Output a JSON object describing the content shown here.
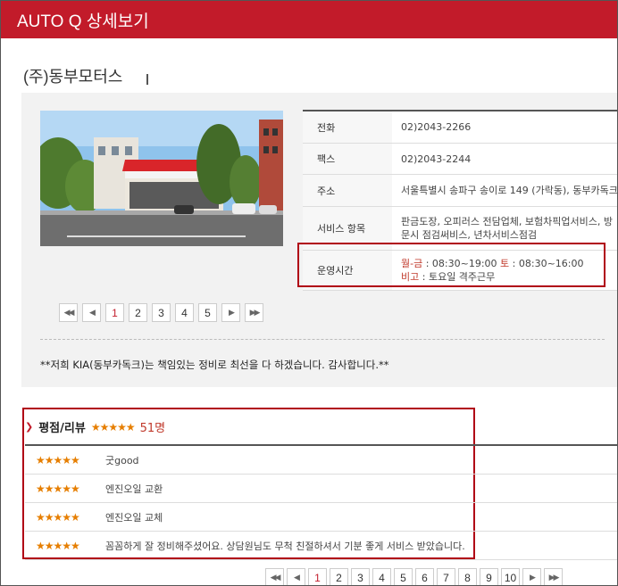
{
  "header": {
    "title": "AUTO Q 상세보기"
  },
  "company": {
    "name": "(주)동부모터스"
  },
  "info": [
    {
      "label": "전화",
      "value": "02)2043-2266"
    },
    {
      "label": "팩스",
      "value": "02)2043-2244"
    },
    {
      "label": "주소",
      "value": "서울특별시 송파구 송이로 149 (가락동), 동부카독크"
    },
    {
      "label": "서비스 항목",
      "value": "판금도장, 오피러스 전담업체, 보험차픽업서비스, 방문시 점검써비스, 년차서비스점검"
    },
    {
      "label": "운영시간",
      "hours_weekday_label": "월-금",
      "hours_weekday": " : 08:30~19:00 ",
      "hours_sat_label": "토",
      "hours_sat": " : 08:30~16:00",
      "note_label": "비고",
      "note": " : 토요일 격주근무"
    }
  ],
  "photo_pager": {
    "first": "◀◀",
    "prev": "◀",
    "pages": [
      "1",
      "2",
      "3",
      "4",
      "5"
    ],
    "next": "▶",
    "last": "▶▶"
  },
  "notice": "**저희 KIA(동부카독크)는 책임있는 정비로 최선을 다 하겠습니다. 감사합니다.**",
  "reviews": {
    "title": "평점/리뷰",
    "rating_stars": "★★★★★",
    "count": "51명",
    "items": [
      {
        "stars": "★★★★★",
        "text": "굿good"
      },
      {
        "stars": "★★★★★",
        "text": "엔진오일 교환"
      },
      {
        "stars": "★★★★★",
        "text": "엔진오일 교체"
      },
      {
        "stars": "★★★★★",
        "text": "꼼꼼하게 잘 정비해주셨어요. 상담원님도 무척 친절하셔서 기분 좋게 서비스 받았습니다."
      }
    ]
  },
  "review_pager": {
    "first": "◀◀",
    "prev": "◀",
    "pages": [
      "1",
      "2",
      "3",
      "4",
      "5",
      "6",
      "7",
      "8",
      "9",
      "10"
    ],
    "next": "▶",
    "last": "▶▶"
  },
  "colors": {
    "brand": "#c21b2a",
    "highlight": "#b00015",
    "star": "#e67e00"
  }
}
